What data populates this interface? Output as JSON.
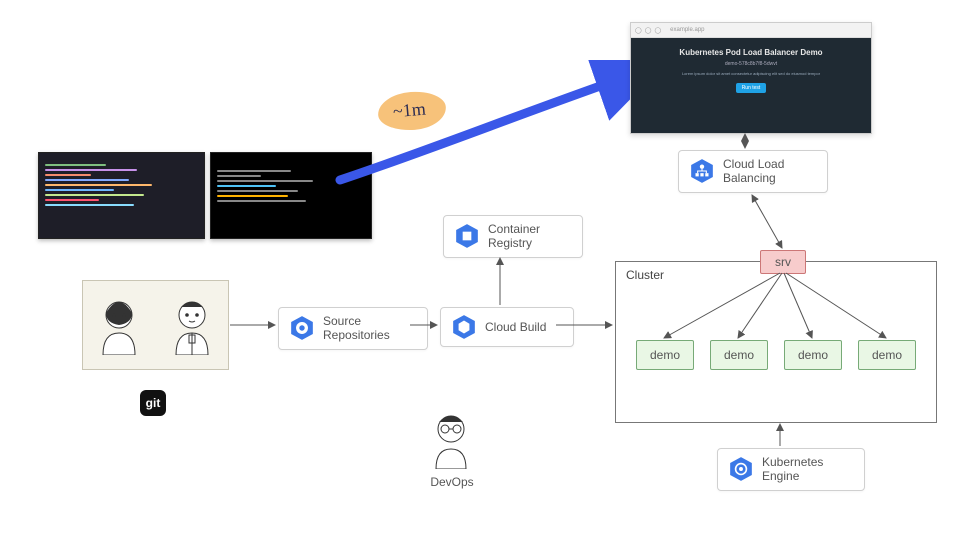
{
  "annotation": "~1m",
  "nodes": {
    "source_repos": "Source\nRepositories",
    "cloud_build": "Cloud Build",
    "container_registry": "Container\nRegistry",
    "kubernetes_engine": "Kubernetes\nEngine",
    "cloud_lb": "Cloud Load\nBalancing"
  },
  "cluster": {
    "title": "Cluster",
    "service": "srv",
    "pods": [
      "demo",
      "demo",
      "demo",
      "demo"
    ]
  },
  "git_label": "git",
  "devops_label": "DevOps",
  "browser": {
    "title": "Kubernetes Pod Load Balancer Demo",
    "subtitle": "demo-578c8b7f8-5dwvt"
  }
}
